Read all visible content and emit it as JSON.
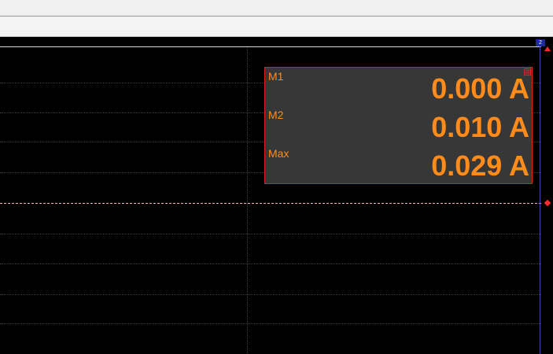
{
  "toolbar": {
    "cursor_tag_label": "2"
  },
  "measurement_panel": {
    "close_glyph": "⊠",
    "rows": [
      {
        "label": "M1",
        "value": "0.000 A"
      },
      {
        "label": "M2",
        "value": "0.010 A"
      },
      {
        "label": "Max",
        "value": "0.029 A"
      }
    ]
  },
  "colors": {
    "background": "#000000",
    "measurement_text": "#ff8c1a",
    "panel_border": "#e21d1d",
    "panel_background": "#373737",
    "trigger_marker": "#ff2a2a",
    "axis_line": "#3a4ba8"
  }
}
